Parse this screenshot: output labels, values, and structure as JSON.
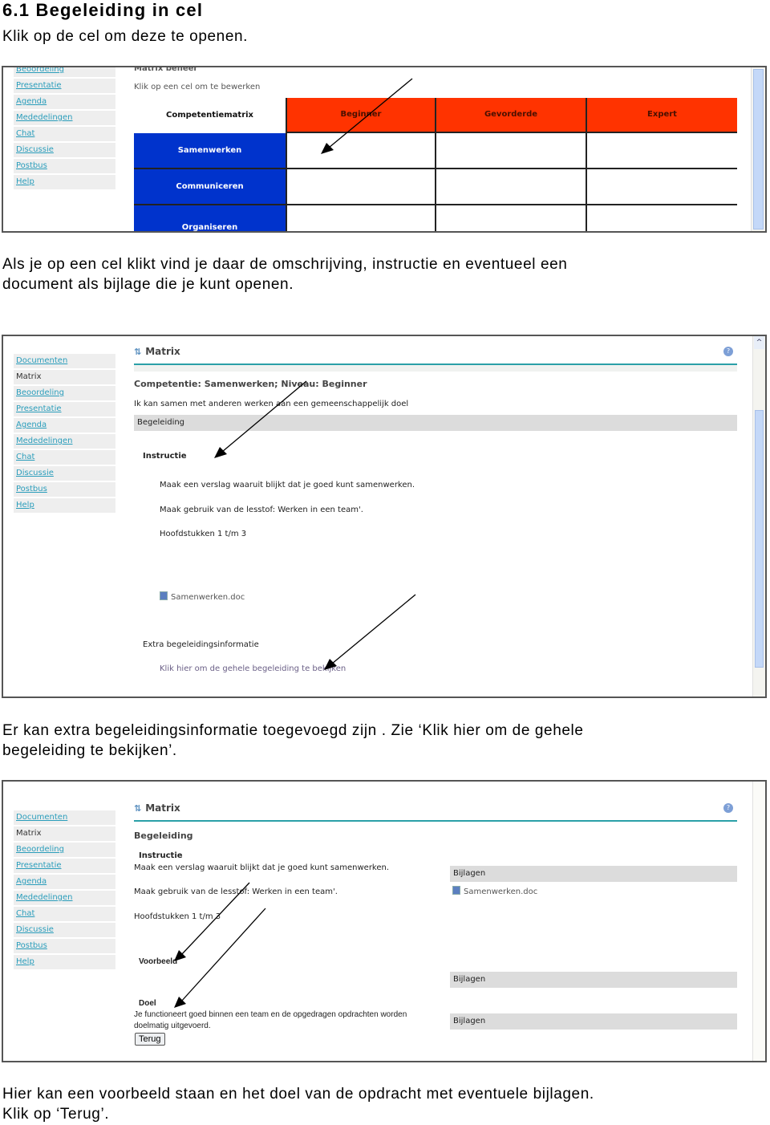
{
  "document": {
    "title": "6.1 Begeleiding in cel",
    "para1": "Klik op de cel om deze te openen.",
    "para2_line1": "Als je op een cel klikt vind je daar de omschrijving, instructie en eventueel een",
    "para2_line2": "document als bijlage die je kunt openen.",
    "para3_line1": "Er kan extra begeleidingsinformatie toegevoegd zijn . Zie ‘Klik hier om de gehele",
    "para3_line2": "begeleiding te bekijken’.",
    "para4_line1": "Hier kan een voorbeeld staan en het doel van de opdracht met eventuele bijlagen.",
    "para4_line2": "Klik op ‘Terug’."
  },
  "screenshot1": {
    "sidebar": [
      "Beoordeling",
      "Presentatie",
      "Agenda",
      "Mededelingen",
      "Chat",
      "Discussie",
      "Postbus",
      "Help"
    ],
    "heading_clipped": "Matrix beheer",
    "instruction": "Klik op een cel om te bewerken",
    "matrix": {
      "corner": "Competentiematrix",
      "levels": [
        "Beginner",
        "Gevorderde",
        "Expert"
      ],
      "competences": [
        "Samenwerken",
        "Communiceren",
        "Organiseren"
      ]
    },
    "colors": {
      "level_header": "#ff3300",
      "competence": "#0033cc"
    }
  },
  "screenshot2": {
    "sidebar": [
      {
        "label": "Documenten",
        "active": false
      },
      {
        "label": "Matrix",
        "active": true
      },
      {
        "label": "Beoordeling",
        "active": false
      },
      {
        "label": "Presentatie",
        "active": false
      },
      {
        "label": "Agenda",
        "active": false
      },
      {
        "label": "Mededelingen",
        "active": false
      },
      {
        "label": "Chat",
        "active": false
      },
      {
        "label": "Discussie",
        "active": false
      },
      {
        "label": "Postbus",
        "active": false
      },
      {
        "label": "Help",
        "active": false
      }
    ],
    "pane_title": "Matrix",
    "competentie_heading": "Competentie: Samenwerken; Niveau: Beginner",
    "description": "Ik kan samen met anderen werken aan een gemeenschappelijk doel",
    "begeleiding_bar": "Begeleiding",
    "instructie_heading": "Instructie",
    "instructie_lines": [
      "Maak een verslag waaruit blijkt dat je goed kunt samenwerken.",
      "Maak gebruik van de lesstof: Werken in een team'.",
      "Hoofdstukken 1 t/m 3"
    ],
    "attachment": "Samenwerken.doc",
    "extra_heading": "Extra begeleidingsinformatie",
    "extra_link": "Klik hier om de gehele begeleiding te bekijken",
    "help_icon": "?",
    "scroll_up": "^"
  },
  "screenshot3": {
    "sidebar": [
      {
        "label": "Documenten",
        "active": false
      },
      {
        "label": "Matrix",
        "active": true
      },
      {
        "label": "Beoordeling",
        "active": false
      },
      {
        "label": "Presentatie",
        "active": false
      },
      {
        "label": "Agenda",
        "active": false
      },
      {
        "label": "Mededelingen",
        "active": false
      },
      {
        "label": "Chat",
        "active": false
      },
      {
        "label": "Discussie",
        "active": false
      },
      {
        "label": "Postbus",
        "active": false
      },
      {
        "label": "Help",
        "active": false
      }
    ],
    "pane_title": "Matrix",
    "begeleiding_heading": "Begeleiding",
    "instructie_heading": "Instructie",
    "instructie_lines": [
      "Maak een verslag waaruit blijkt dat je goed kunt samenwerken.",
      "Maak gebruik van de lesstof: Werken in een team'.",
      "Hoofdstukken 1 t/m 3"
    ],
    "voorbeeld_heading": "Voorbeeld",
    "doel_heading": "Doel",
    "doel_line1": "Je functioneert goed binnen een team en de opgedragen opdrachten worden",
    "doel_line2": "doelmatig uitgevoerd.",
    "terug_button": "Terug",
    "bijlagen": [
      "Bijlagen",
      "Bijlagen",
      "Bijlagen"
    ],
    "attachment": "Samenwerken.doc",
    "help_icon": "?"
  }
}
